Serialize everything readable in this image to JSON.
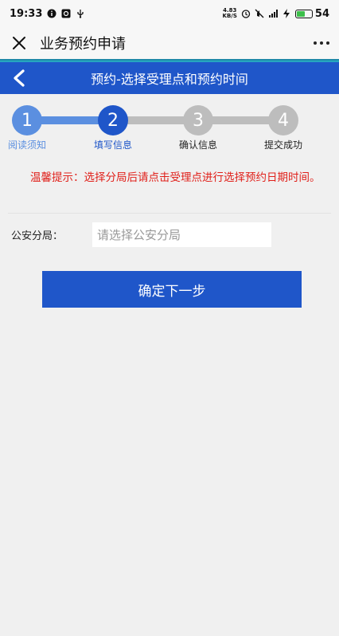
{
  "status_bar": {
    "time": "19:33",
    "net_speed_value": "4.83",
    "net_speed_unit": "KB/S",
    "battery": "54",
    "icons": [
      "info-circle-icon",
      "image-icon",
      "usb-icon",
      "alarm-icon",
      "mute-icon",
      "signal-icon",
      "charging-icon",
      "battery-icon"
    ]
  },
  "title_bar": {
    "title": "业务预约申请",
    "icons": [
      "close-icon",
      "more-icon"
    ]
  },
  "header": {
    "title": "预约-选择受理点和预约时间",
    "icon": "chevron-left-icon"
  },
  "steps": [
    {
      "number": "1",
      "label": "阅读须知",
      "state": "done"
    },
    {
      "number": "2",
      "label": "填写信息",
      "state": "active"
    },
    {
      "number": "3",
      "label": "确认信息",
      "state": "pending"
    },
    {
      "number": "4",
      "label": "提交成功",
      "state": "pending"
    }
  ],
  "notice": {
    "text": "温馨提示：选择分局后请点击受理点进行选择预约日期时间。"
  },
  "form": {
    "branch_label": "公安分局：",
    "branch_placeholder": "请选择公安分局",
    "branch_value": ""
  },
  "actions": {
    "next_label": "确定下一步"
  },
  "colors": {
    "primary": "#1f56c9",
    "step_done": "#5b8fe0",
    "step_pending": "#bdbdbd",
    "notice": "#e0201a",
    "background": "#f0f0f0"
  }
}
